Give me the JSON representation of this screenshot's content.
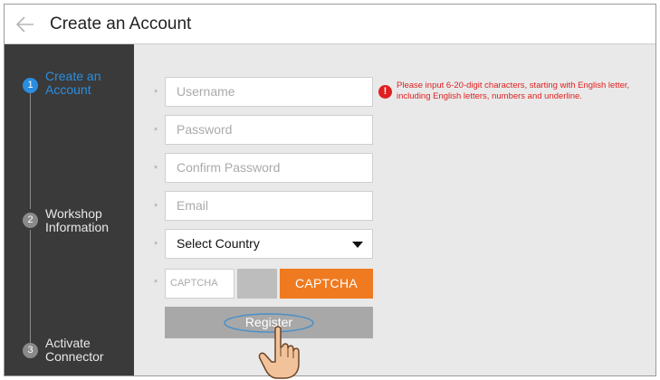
{
  "header": {
    "title": "Create an Account",
    "back_icon": "back-arrow-icon"
  },
  "steps": [
    {
      "number": "1",
      "label_line1": "Create an",
      "label_line2": "Account",
      "active": true
    },
    {
      "number": "2",
      "label_line1": "Workshop",
      "label_line2": "Information",
      "active": false
    },
    {
      "number": "3",
      "label_line1": "Activate",
      "label_line2": "Connector",
      "active": false
    }
  ],
  "form": {
    "required_marker": "*",
    "username_placeholder": "Username",
    "password_placeholder": "Password",
    "confirm_password_placeholder": "Confirm Password",
    "email_placeholder": "Email",
    "country_selected": "Select Country",
    "captcha_placeholder": "CAPTCHA",
    "captcha_button": "CAPTCHA",
    "register_button": "Register"
  },
  "error": {
    "icon": "!",
    "message": "Please input 6-20-digit characters, starting with English letter, including English letters, numbers and underline."
  },
  "colors": {
    "sidebar": "#3a3a3a",
    "active_step": "#2a8ee0",
    "inactive_step": "#8a8a8a",
    "captcha_button": "#f07a1f",
    "register_button": "#a8a8a8",
    "error": "#e02020"
  }
}
